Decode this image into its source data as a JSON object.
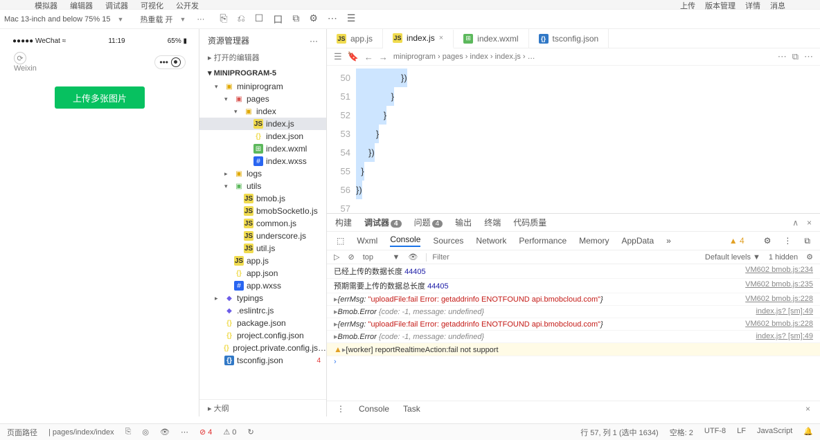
{
  "topmenu": {
    "left": [
      "模拟器",
      "编辑器",
      "调试器",
      "可视化",
      "公开发"
    ],
    "right": [
      "上传",
      "版本管理",
      "详情",
      "消息"
    ]
  },
  "subbar": {
    "device": "Mac 13-inch and below 75% 15",
    "reload": "热重载 开",
    "dots": "···",
    "codeicons": [
      "⎘",
      "⎌",
      "☐",
      "口",
      "⧉",
      "⚙",
      "⋯",
      "☰"
    ]
  },
  "sim": {
    "carrier": "WeChat",
    "signal": "●●●●●",
    "time": "11:19",
    "battery": "65%",
    "wx": "Weixin",
    "pill": "•••",
    "button": "上传多张图片"
  },
  "explorer": {
    "title": "资源管理器",
    "dots": "···",
    "sections": [
      "打开的编辑器",
      "MINIPROGRAM-5"
    ],
    "tree": [
      {
        "d": 1,
        "c": "▾",
        "ic": "folder",
        "t": "miniprogram"
      },
      {
        "d": 2,
        "c": "▾",
        "ic": "folder-red",
        "t": "pages"
      },
      {
        "d": 3,
        "c": "▾",
        "ic": "folder",
        "t": "index"
      },
      {
        "d": 4,
        "c": "",
        "ic": "js",
        "t": "index.js",
        "sel": true
      },
      {
        "d": 4,
        "c": "",
        "ic": "json",
        "t": "index.json"
      },
      {
        "d": 4,
        "c": "",
        "ic": "wxml",
        "t": "index.wxml"
      },
      {
        "d": 4,
        "c": "",
        "ic": "wxss",
        "t": "index.wxss"
      },
      {
        "d": 2,
        "c": "▸",
        "ic": "folder",
        "t": "logs"
      },
      {
        "d": 2,
        "c": "▾",
        "ic": "folder-gr",
        "t": "utils"
      },
      {
        "d": 3,
        "c": "",
        "ic": "js",
        "t": "bmob.js"
      },
      {
        "d": 3,
        "c": "",
        "ic": "js",
        "t": "bmobSocketIo.js"
      },
      {
        "d": 3,
        "c": "",
        "ic": "js",
        "t": "common.js"
      },
      {
        "d": 3,
        "c": "",
        "ic": "js",
        "t": "underscore.js"
      },
      {
        "d": 3,
        "c": "",
        "ic": "js",
        "t": "util.js"
      },
      {
        "d": 2,
        "c": "",
        "ic": "js",
        "t": "app.js"
      },
      {
        "d": 2,
        "c": "",
        "ic": "json",
        "t": "app.json"
      },
      {
        "d": 2,
        "c": "",
        "ic": "wxss",
        "t": "app.wxss"
      },
      {
        "d": 1,
        "c": "▸",
        "ic": "extra",
        "t": "typings"
      },
      {
        "d": 1,
        "c": "",
        "ic": "extra",
        "t": ".eslintrc.js"
      },
      {
        "d": 1,
        "c": "",
        "ic": "json",
        "t": "package.json"
      },
      {
        "d": 1,
        "c": "",
        "ic": "json",
        "t": "project.config.json"
      },
      {
        "d": 1,
        "c": "",
        "ic": "json",
        "t": "project.private.config.js…"
      },
      {
        "d": 1,
        "c": "",
        "ic": "ts",
        "t": "tsconfig.json",
        "err": "4"
      }
    ],
    "outline": "大纲"
  },
  "tabs": [
    {
      "ic": "js",
      "t": "app.js"
    },
    {
      "ic": "js",
      "t": "index.js",
      "active": true,
      "close": "×"
    },
    {
      "ic": "wxml",
      "t": "index.wxml"
    },
    {
      "ic": "ts",
      "t": "tsconfig.json"
    }
  ],
  "crumbs": {
    "icons": [
      "☰",
      "🔖",
      "←",
      "→"
    ],
    "path": [
      "miniprogram",
      "pages",
      "index",
      "index.js",
      "…"
    ],
    "right": [
      "⋯",
      "⧉",
      "⋯"
    ]
  },
  "code": {
    "lines": [
      {
        "n": 50,
        "t": "                    })",
        "pad": 18
      },
      {
        "n": 51,
        "t": "              }",
        "pad": 14
      },
      {
        "n": 52,
        "t": "           }",
        "pad": 11
      },
      {
        "n": 53,
        "t": "        }",
        "pad": 8
      },
      {
        "n": 54,
        "t": "     })",
        "pad": 5
      },
      {
        "n": 55,
        "t": "  }",
        "pad": 2
      },
      {
        "n": 56,
        "t": "})",
        "pad": 0
      },
      {
        "n": 57,
        "t": "",
        "pad": -1
      }
    ]
  },
  "devtools": {
    "top": [
      {
        "t": "构建"
      },
      {
        "t": "调试器",
        "b": "4",
        "a": true
      },
      {
        "t": "问题",
        "b": "4"
      },
      {
        "t": "输出"
      },
      {
        "t": "终端"
      },
      {
        "t": "代码质量"
      }
    ],
    "topright": [
      "∧",
      "×"
    ],
    "sub": [
      "⬚",
      "Wxml",
      "Console",
      "Sources",
      "Network",
      "Performance",
      "Memory",
      "AppData",
      "»"
    ],
    "subwarn": "▲ 4",
    "subicons": [
      "⚙",
      "⋮",
      "⧉"
    ],
    "filter": {
      "icons": [
        "▷",
        "⊘"
      ],
      "ctx": "top",
      "eye": "👁",
      "ph": "Filter",
      "levels": "Default levels ▼",
      "hidden": "1 hidden",
      "gear": "⚙"
    },
    "lines": [
      {
        "pre": "已经上传的数据长度 ",
        "v": "44405",
        "src": "VM602 bmob.js:234"
      },
      {
        "pre": "预期需要上传的数据总长度 ",
        "v": "44405",
        "src": "VM602 bmob.js:235"
      },
      {
        "tri": "▸",
        "obj1": "{errMsg: ",
        "s": "\"uploadFile:fail Error: getaddrinfo ENOTFOUND api.bmobcloud.com\"",
        "obj2": "}",
        "src": "VM602 bmob.js:228"
      },
      {
        "tri": "▸",
        "obj1": "Bmob.Error ",
        "gray": "{code: -1, message: undefined}",
        "src": "index.js? [sm]:49"
      },
      {
        "tri": "▸",
        "obj1": "{errMsg: ",
        "s": "\"uploadFile:fail Error: getaddrinfo ENOTFOUND api.bmobcloud.com\"",
        "obj2": "}",
        "src": "VM602 bmob.js:228"
      },
      {
        "tri": "▸",
        "obj1": "Bmob.Error ",
        "gray": "{code: -1, message: undefined}",
        "src": "index.js? [sm]:49"
      },
      {
        "warn": true,
        "tri": "▸",
        "msg": "[worker] reportRealtimeAction:fail not support"
      }
    ],
    "prompt": "›",
    "bottom": {
      "dots": "⋮",
      "t1": "Console",
      "t2": "Task",
      "x": "×"
    }
  },
  "status": {
    "l1": "页面路径",
    "l2": "pages/index/index",
    "icons": [
      "⎘",
      "◎",
      "👁",
      "⋯"
    ],
    "errs": "⊘ 4",
    "warns": "⚠ 0",
    "scroll": "↻",
    "pos": "行 57, 列 1 (选中 1634)",
    "space": "空格: 2",
    "enc": "UTF-8",
    "eol": "LF",
    "lang": "JavaScript",
    "bell": "🔔"
  }
}
